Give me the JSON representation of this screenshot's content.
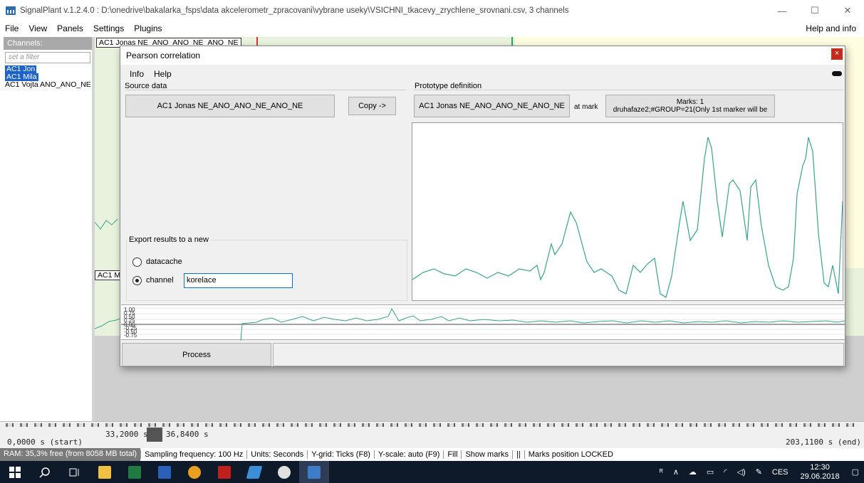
{
  "window": {
    "title": "SignalPlant v.1.2.4.0 : D:\\onedrive\\bakalarka_fsps\\data akcelerometr_zpracovani\\vybrane useky\\VSICHNI_tkacevy_zrychlene_srovnani.csv, 3 channels",
    "minimize": "—",
    "maximize": "☐",
    "close": "✕"
  },
  "menu": {
    "items": [
      "File",
      "View",
      "Panels",
      "Settings",
      "Plugins"
    ],
    "right": "Help and info"
  },
  "channels": {
    "header": "Channels:",
    "filter_placeholder": "set a filter",
    "items": [
      "AC1 Jon",
      "AC1 Mila",
      "AC1 Vojta ANO_ANO_NE"
    ]
  },
  "signals": {
    "label_top": "AC1 Jonas NE_ANO_ANO_NE_ANO_NE",
    "label_mid": "AC1 M"
  },
  "dialog": {
    "title": "Pearson correlation",
    "close": "×",
    "menu": [
      "Info",
      "Help"
    ],
    "source_label": "Source data",
    "source_channel": "AC1 Jonas NE_ANO_ANO_NE_ANO_NE",
    "copy_button": "Copy ->",
    "prototype_label": "Prototype definition",
    "prototype_channel": "AC1 Jonas NE_ANO_ANO_NE_ANO_NE",
    "at_mark": "at mark",
    "marks_line1": "Marks: 1",
    "marks_line2": "druhafaze2;#GROUP=21(Only 1st marker will be",
    "export_label": "Export results to a new",
    "radio_datacache": "datacache",
    "radio_channel": "channel",
    "selected_radio": "channel",
    "channel_name_value": "korelace",
    "process_button": "Process",
    "mini_axis": [
      "1.00",
      "0.75",
      "0.50",
      "0.25",
      "0.00",
      "-0.25",
      "-0.50",
      "-0.75"
    ]
  },
  "timeline": {
    "start": "0,0000 s (start)",
    "pos1": "33,2000 s",
    "pos2": "36,8400 s",
    "end": "203,1100 s (end)"
  },
  "status": {
    "ram": "RAM: 35,3% free (from 8058 MB total)",
    "items": [
      "Sampling frequency: 100 Hz",
      "Units: Seconds",
      "Y-grid: Ticks (F8)",
      "Y-scale: auto (F9)",
      "Fill",
      "Show marks",
      "||",
      "Marks position LOCKED"
    ]
  },
  "taskbar": {
    "tray_lang": "CES",
    "time": "12:30",
    "date": "29.06.2018"
  },
  "colors": {
    "trace": "#3aa58a",
    "selection": "#1e64c8",
    "taskbar": "#0e1a2a",
    "close_red": "#c42b1c"
  }
}
